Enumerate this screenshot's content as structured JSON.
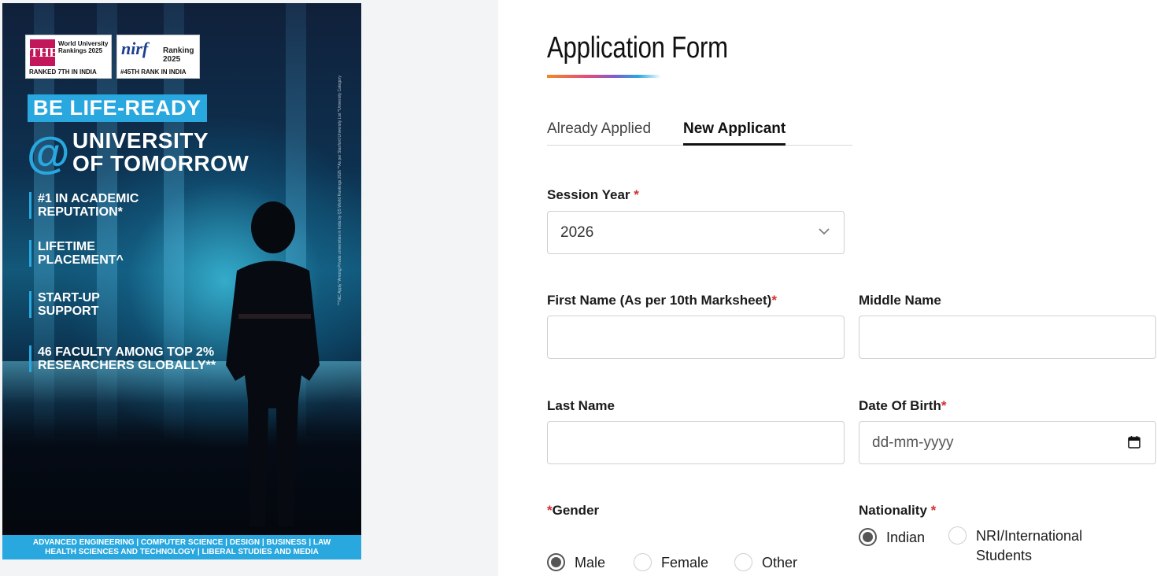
{
  "poster": {
    "the_badge": {
      "logo": "THE",
      "title": "World University Rankings 2025",
      "footer": "RANKED 7TH IN INDIA"
    },
    "nirf_badge": {
      "logo": "nirf",
      "ranking": "Ranking",
      "year": "2025",
      "footer": "#45TH RANK IN INDIA"
    },
    "headline": "BE LIFE-READY",
    "at": "@",
    "university_line1": "UNIVERSITY",
    "university_line2": "OF TOMORROW",
    "highlights": [
      {
        "line1": "#1 IN ACADEMIC",
        "line2": "REPUTATION*"
      },
      {
        "line1": "LIFETIME",
        "line2": "PLACEMENT^"
      },
      {
        "line1": "START-UP",
        "line2": "SUPPORT"
      },
      {
        "line1": "46 FACULTY AMONG TOP 2%",
        "line2": "RESEARCHERS GLOBALLY**"
      }
    ],
    "footer_line1": "ADVANCED ENGINEERING | COMPUTER SCIENCE | DESIGN | BUSINESS | LAW",
    "footer_line2": "HEALTH SCIENCES AND TECHNOLOGY | LIBERAL STUDIES AND MEDIA",
    "side_note": "**T&C Apply *Among Private universities in India by QS World Rankings 2026 **As per Stanford University List ^University Category"
  },
  "form": {
    "title": "Application Form",
    "tabs": {
      "already_applied": "Already Applied",
      "new_applicant": "New Applicant"
    },
    "session_year": {
      "label": "Session Year",
      "required": "*",
      "value": "2026"
    },
    "first_name": {
      "label": "First Name (As per 10th Marksheet)",
      "required": "*",
      "value": ""
    },
    "middle_name": {
      "label": "Middle Name",
      "value": ""
    },
    "last_name": {
      "label": "Last Name",
      "value": ""
    },
    "dob": {
      "label": "Date Of Birth",
      "required": "*",
      "placeholder": "dd-mm-yyyy"
    },
    "gender": {
      "required": "*",
      "label": "Gender",
      "options": [
        "Male",
        "Female",
        "Other"
      ],
      "selected": "Male"
    },
    "nationality": {
      "label": "Nationality",
      "required": "*",
      "options": [
        "Indian",
        "NRI/International",
        "Students"
      ],
      "selected": "Indian"
    }
  }
}
